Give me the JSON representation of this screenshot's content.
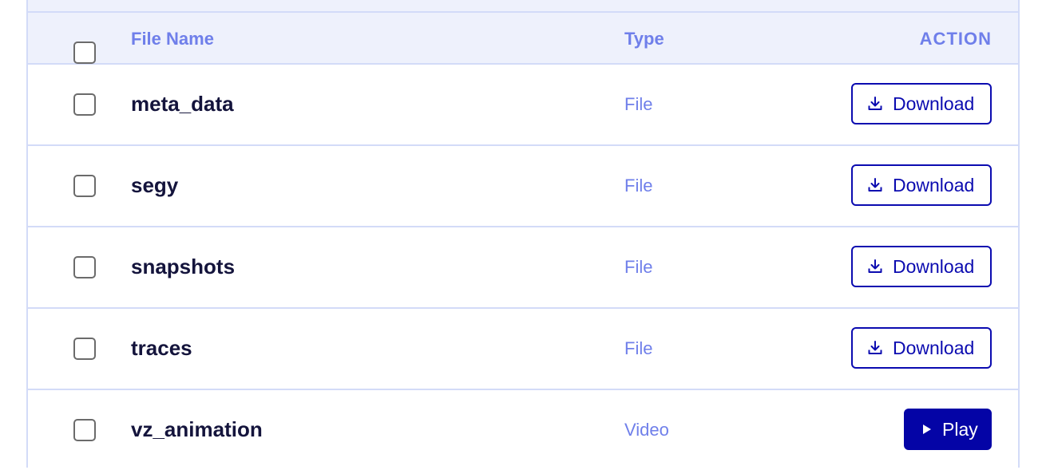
{
  "table": {
    "headers": {
      "name": "File Name",
      "type": "Type",
      "action": "ACTION"
    },
    "rows": [
      {
        "name": "meta_data",
        "type": "File",
        "action": "Download",
        "action_icon": "download-icon"
      },
      {
        "name": "segy",
        "type": "File",
        "action": "Download",
        "action_icon": "download-icon"
      },
      {
        "name": "snapshots",
        "type": "File",
        "action": "Download",
        "action_icon": "download-icon"
      },
      {
        "name": "traces",
        "type": "File",
        "action": "Download",
        "action_icon": "download-icon"
      },
      {
        "name": "vz_animation",
        "type": "Video",
        "action": "Play",
        "action_icon": "play-icon"
      }
    ]
  },
  "colors": {
    "header_bg": "#eef1fc",
    "border": "#d3dbf8",
    "header_text": "#6f7fea",
    "accent": "#0404a6",
    "name_text": "#14143c"
  }
}
